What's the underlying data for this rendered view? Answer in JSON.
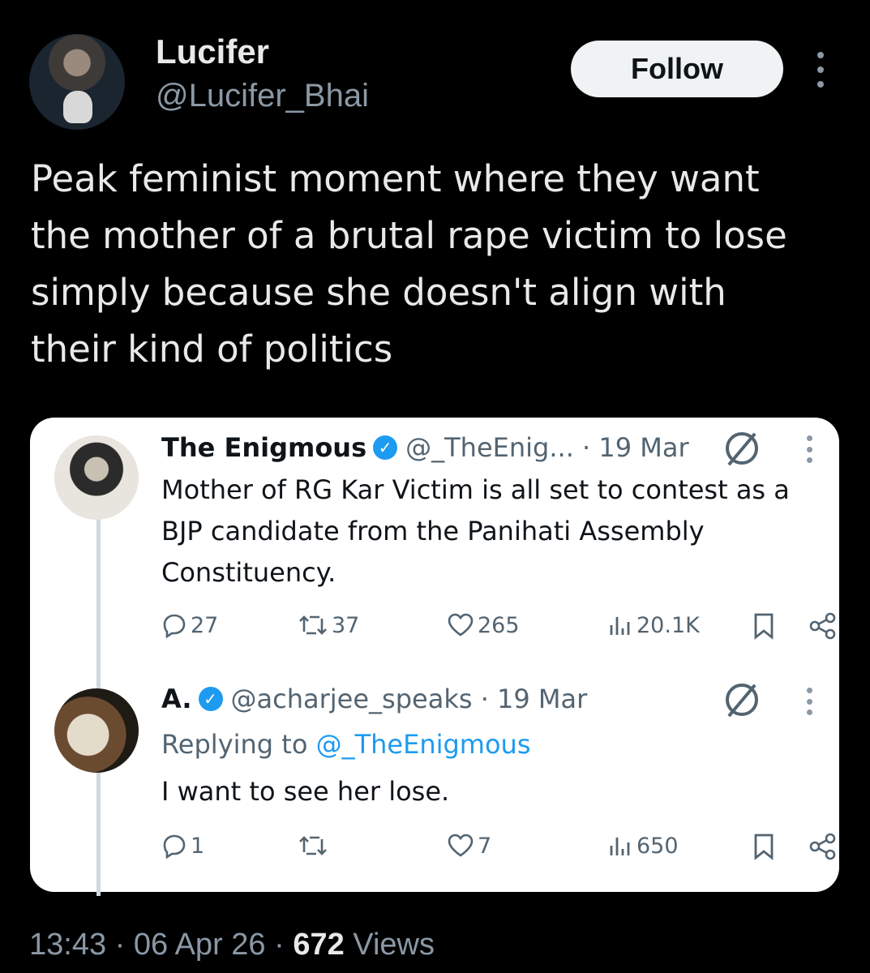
{
  "author": {
    "name": "Lucifer",
    "handle": "@Lucifer_Bhai",
    "follow_label": "Follow"
  },
  "tweet": {
    "lines": [
      "Peak feminist moment where they want",
      "the mother of a brutal rape victim to lose",
      "simply because she doesn't align with",
      "their kind of politics"
    ]
  },
  "quote": {
    "post1": {
      "name": "The Enigmous",
      "handle_time": "@_TheEnig... · 19 Mar",
      "body_lines": [
        "Mother of RG Kar Victim is all set to contest as a",
        "BJP candidate from the Panihati Assembly",
        "Constituency."
      ],
      "stats": {
        "replies": "27",
        "reposts": "37",
        "likes": "265",
        "views": "20.1K"
      }
    },
    "post2": {
      "name": "A.",
      "handle_time": "@acharjee_speaks · 19 Mar",
      "replying_prefix": "Replying to ",
      "replying_handle": "@_TheEnigmous",
      "body": "I want to see her lose.",
      "stats": {
        "replies": "1",
        "reposts": "",
        "likes": "7",
        "views": "650"
      }
    }
  },
  "footer": {
    "time_date": "13:43 · 06 Apr 26 · ",
    "views_count": "672",
    "views_label": " Views"
  },
  "colors": {
    "background": "#000000",
    "card": "#ffffff",
    "link_blue": "#1d9bf0",
    "muted": "#536471"
  }
}
